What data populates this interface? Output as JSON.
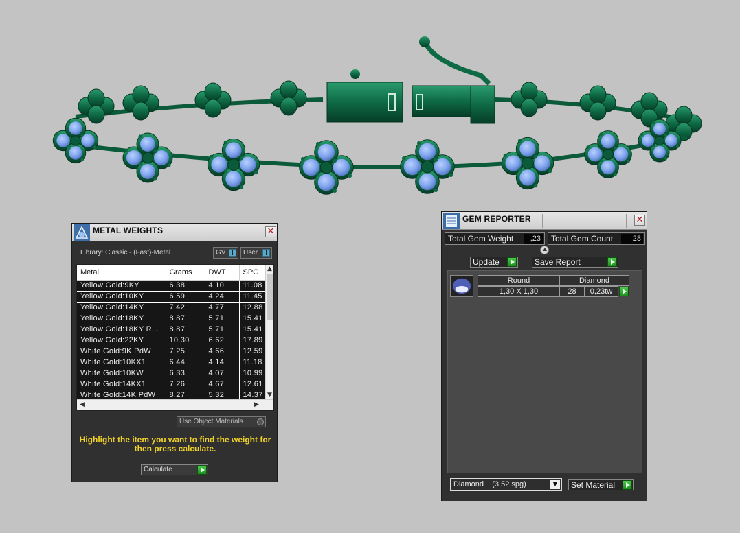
{
  "metal_weights": {
    "title": "METAL WEIGHTS",
    "library_label": "Library: Classic - (Fast)-Metal",
    "gv_label": "GV",
    "user_label": "User",
    "columns": [
      "Metal",
      "Grams",
      "DWT",
      "SPG"
    ],
    "rows": [
      [
        "Yellow Gold:9KY",
        "6.38",
        "4.10",
        "11.08"
      ],
      [
        "Yellow Gold:10KY",
        "6.59",
        "4.24",
        "11.45"
      ],
      [
        "Yellow Gold:14KY",
        "7.42",
        "4.77",
        "12.88"
      ],
      [
        "Yellow Gold:18KY",
        "8.87",
        "5.71",
        "15.41"
      ],
      [
        "Yellow Gold:18KY R...",
        "8.87",
        "5.71",
        "15.41"
      ],
      [
        "Yellow Gold:22KY",
        "10.30",
        "6.62",
        "17.89"
      ],
      [
        "White Gold:9K PdW",
        "7.25",
        "4.66",
        "12.59"
      ],
      [
        "White Gold:10KX1",
        "6.44",
        "4.14",
        "11.18"
      ],
      [
        "White Gold:10KW",
        "6.33",
        "4.07",
        "10.99"
      ],
      [
        "White Gold:14KX1",
        "7.26",
        "4.67",
        "12.61"
      ],
      [
        "White Gold:14K PdW",
        "8.27",
        "5.32",
        "14.37"
      ]
    ],
    "use_object_label": "Use Object Materials",
    "hint": "Highlight the item you want to find the weight for then press calculate.",
    "calculate_label": "Calculate"
  },
  "gem_reporter": {
    "title": "GEM REPORTER",
    "total_weight_label": "Total Gem Weight",
    "total_weight_value": ",23",
    "total_count_label": "Total Gem Count",
    "total_count_value": "28",
    "update_label": "Update",
    "save_report_label": "Save Report",
    "gems": [
      {
        "shape": "Round",
        "size": "1,30 X 1,30",
        "material": "Diamond",
        "count": "28",
        "weight": "0,23tw"
      }
    ],
    "material_selected": "Diamond    (3,52 spg)",
    "set_material_label": "Set Material"
  },
  "colors": {
    "metal": "#0e6a45",
    "gem": "#7ea3ec",
    "accent_green": "#2aa82a",
    "hint_yellow": "#f0d12a"
  }
}
